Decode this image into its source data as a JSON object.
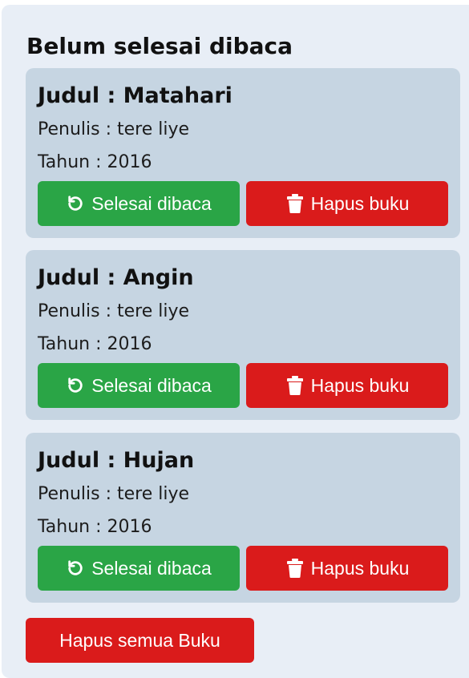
{
  "section": {
    "title": "Belum selesai dibaca"
  },
  "books": [
    {
      "title": "Judul : Matahari",
      "author": "Penulis : tere liye",
      "year": "Tahun : 2016",
      "done_label": "Selesai dibaca",
      "delete_label": "Hapus buku"
    },
    {
      "title": "Judul : Angin",
      "author": "Penulis : tere liye",
      "year": "Tahun : 2016",
      "done_label": "Selesai dibaca",
      "delete_label": "Hapus buku"
    },
    {
      "title": "Judul : Hujan",
      "author": "Penulis : tere liye",
      "year": "Tahun : 2016",
      "done_label": "Selesai dibaca",
      "delete_label": "Hapus buku"
    }
  ],
  "actions": {
    "delete_all_label": "Hapus semua Buku"
  },
  "icons": {
    "done": "undo-icon",
    "delete": "trash-icon"
  },
  "colors": {
    "panel_background": "#e8eef6",
    "card_background": "#c6d5e2",
    "done_button": "#2aa546",
    "delete_button": "#da1b1b",
    "button_text": "#ffffff"
  }
}
